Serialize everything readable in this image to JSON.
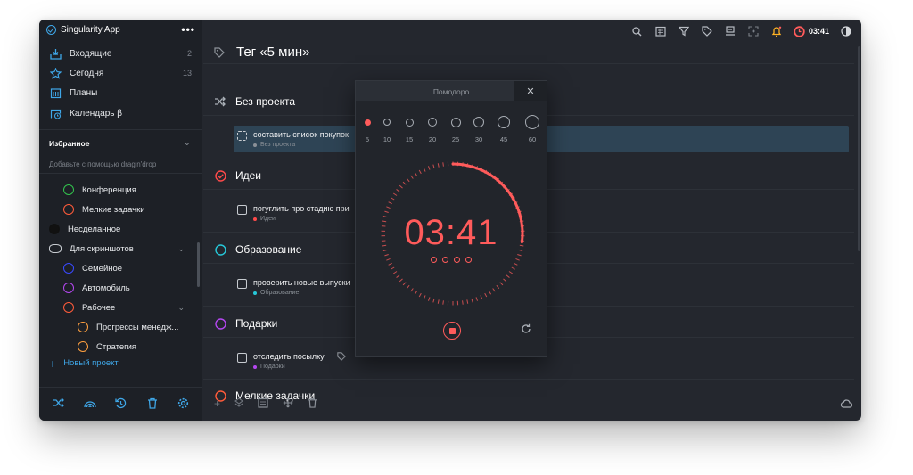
{
  "app": {
    "title": "Singularity App",
    "menu": "•••"
  },
  "sidebar": {
    "nav": [
      {
        "label": "Входящие",
        "count": "2",
        "icon": "inbox-icon"
      },
      {
        "label": "Сегодня",
        "count": "13",
        "icon": "star-icon"
      },
      {
        "label": "Планы",
        "count": "",
        "icon": "calendar-grid-icon"
      },
      {
        "label": "Календарь β",
        "count": "",
        "icon": "calendar-clock-icon"
      }
    ],
    "favorites_label": "Избранное",
    "favorites_hint": "Добавьте с помощью drag'n'drop",
    "projects": [
      {
        "label": "Конференция",
        "color": "#32c24d",
        "indent": 2
      },
      {
        "label": "Мелкие задачки",
        "color": "#ff5b3a",
        "indent": 2
      },
      {
        "label": "Несделанное",
        "color": "#111111",
        "indent": 1
      },
      {
        "label": "Для скриншотов",
        "color": "#c7cbd0",
        "indent": 1,
        "chevron": true,
        "folder": true
      },
      {
        "label": "Семейное",
        "color": "#3949ff",
        "indent": 2
      },
      {
        "label": "Автомобиль",
        "color": "#b447f0",
        "indent": 2
      },
      {
        "label": "Рабочее",
        "color": "#ff5b3a",
        "indent": 2,
        "chevron": true
      },
      {
        "label": "Прогрессы менедж...",
        "color": "#ffa040",
        "indent": 3
      },
      {
        "label": "Стратегия",
        "color": "#ffa040",
        "indent": 3
      }
    ],
    "new_project": "Новый проект"
  },
  "topbar": {
    "timer": "03:41"
  },
  "main": {
    "title": "Тег «5 мин»",
    "sections": [
      {
        "name": "Без проекта",
        "color": "#aab0b7",
        "icon": "shuffle-icon"
      },
      {
        "name": "Идеи",
        "color": "#ff4a4a",
        "icon": "check-circle-icon"
      },
      {
        "name": "Образование",
        "color": "#27c7d8",
        "icon": "ring-icon"
      },
      {
        "name": "Подарки",
        "color": "#b447f0",
        "icon": "ring-icon"
      },
      {
        "name": "Мелкие задачки",
        "color": "#ff5b3a",
        "icon": "ring-icon"
      }
    ],
    "tasks": [
      {
        "title": "составить список покупок",
        "project": "Без проекта",
        "dot": "#8a9097"
      },
      {
        "title": "погуглить про стадию при",
        "project": "Идеи",
        "dot": "#ff4a4a"
      },
      {
        "title": "проверить новые выпуски",
        "project": "Образование",
        "dot": "#27c7d8"
      },
      {
        "title": "отследить посылку",
        "project": "Подарки",
        "dot": "#b447f0"
      }
    ]
  },
  "pomodoro": {
    "title": "Помодоро",
    "close": "✕",
    "presets": [
      "5",
      "10",
      "15",
      "20",
      "25",
      "30",
      "45",
      "60"
    ],
    "active_preset": "5",
    "time": "03:41",
    "remaining_fraction": 0.27,
    "cycles": 4,
    "accent": "#ff5b5b"
  }
}
